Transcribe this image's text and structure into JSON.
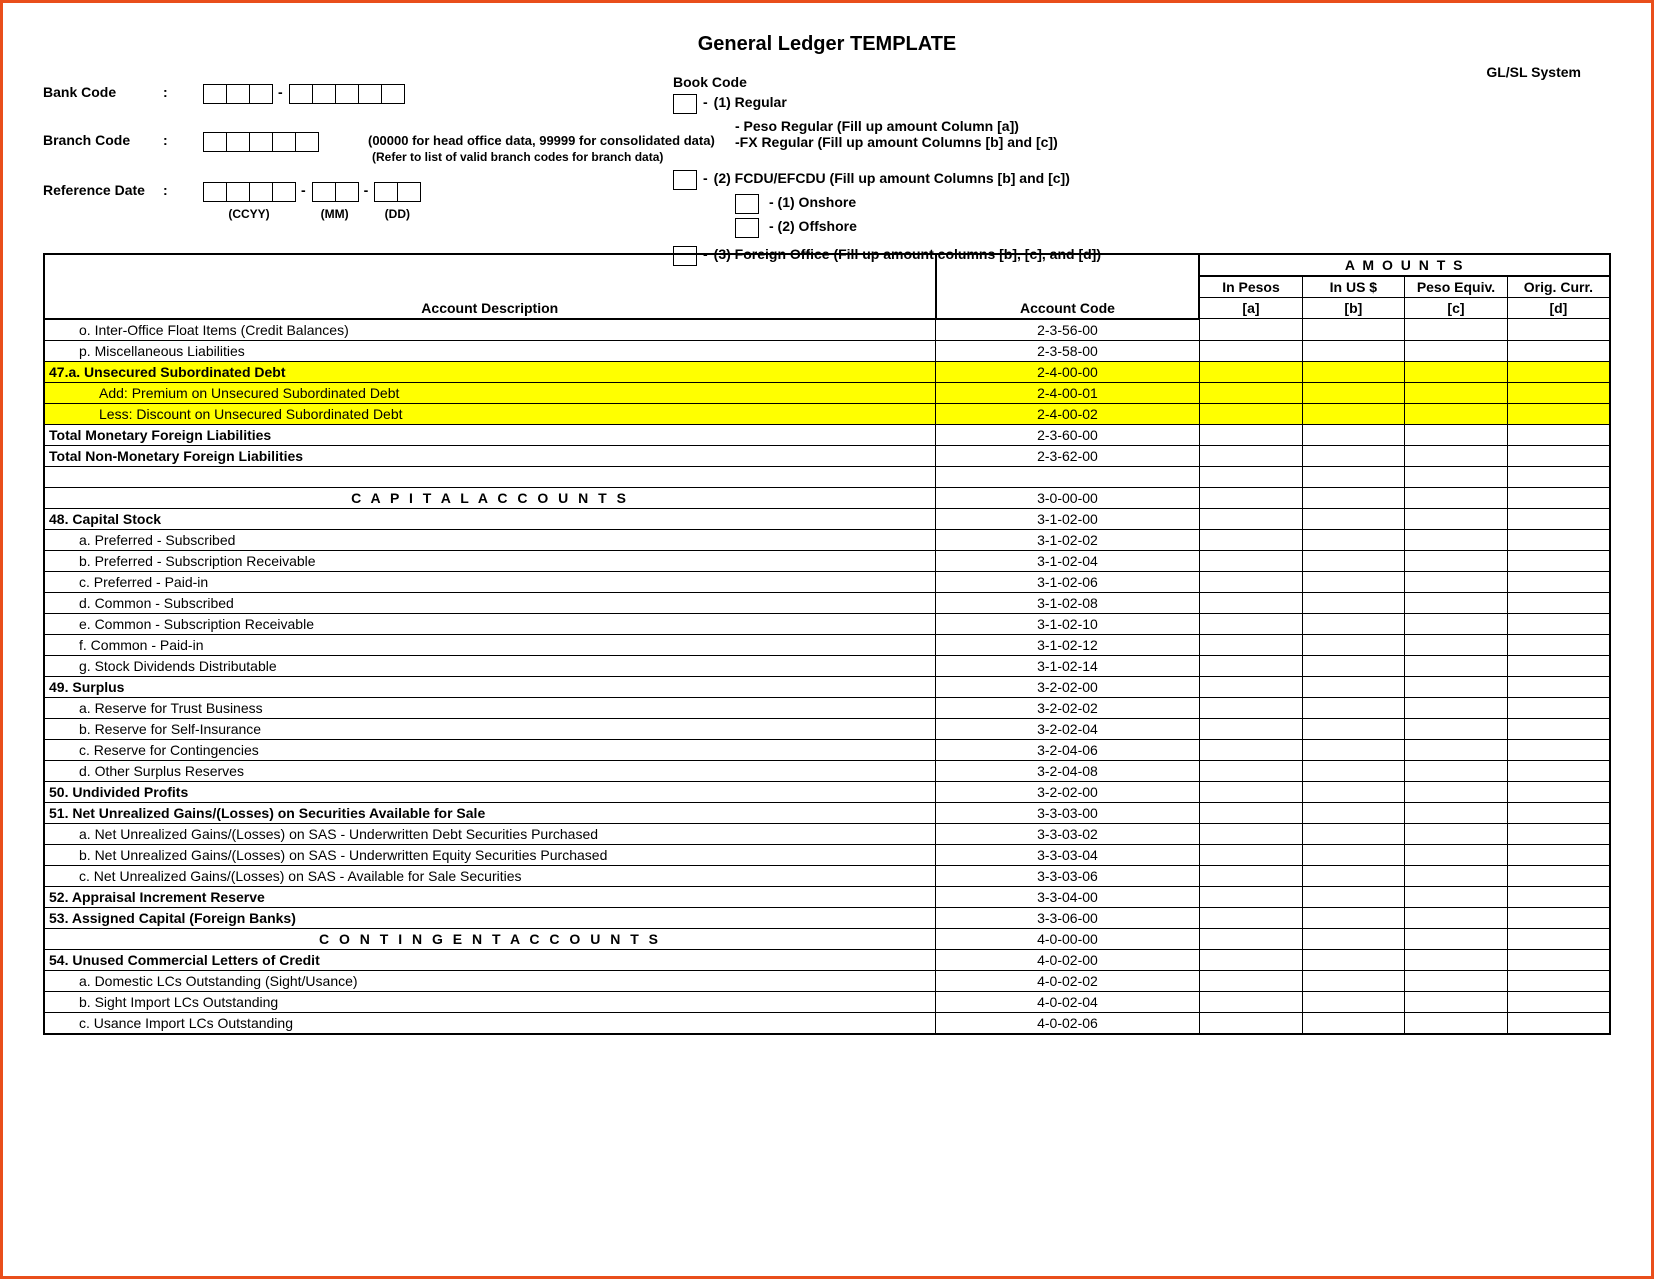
{
  "title": "General Ledger TEMPLATE",
  "system_label": "GL/SL System",
  "header": {
    "bank_code_label": "Bank Code",
    "branch_code_label": "Branch Code",
    "branch_note1": "(00000 for head office data, 99999 for consolidated data)",
    "branch_note2": "(Refer to list of valid branch codes for branch data)",
    "ref_date_label": "Reference Date",
    "ccyy": "(CCYY)",
    "mm": "(MM)",
    "dd": "(DD)",
    "book_code_label": "Book Code",
    "bc1": "(1) Regular",
    "bc1a": "- Peso Regular (Fill up amount Column [a])",
    "bc1b": "-FX Regular (Fill up amount Columns [b] and [c])",
    "bc2": "(2) FCDU/EFCDU (Fill up amount Columns [b] and [c])",
    "bc2a": "-   (1) Onshore",
    "bc2b": "-   (2) Offshore",
    "bc3": "(3) Foreign Office (Fill up amount columns [b], [c], and [d])"
  },
  "table_headers": {
    "amounts": "A M O U N T S",
    "desc": "Account Description",
    "code": "Account Code",
    "pesos": "In Pesos",
    "usd": "In US $",
    "peq": "Peso Equiv.",
    "orig": "Orig. Curr.",
    "a": "[a]",
    "b": "[b]",
    "c": "[c]",
    "d": "[d]"
  },
  "rows": [
    {
      "desc": "o.  Inter-Office Float Items (Credit Balances)",
      "code": "2-3-56-00",
      "indent": 1
    },
    {
      "desc": "p.  Miscellaneous Liabilities",
      "code": "2-3-58-00",
      "indent": 1
    },
    {
      "desc": "47.a.  Unsecured Subordinated Debt",
      "code": "2-4-00-00",
      "indent": 0,
      "bold": true,
      "hl": true
    },
    {
      "desc": "Add:  Premium on Unsecured Subordinated Debt",
      "code": "2-4-00-01",
      "indent": 2,
      "hl": true
    },
    {
      "desc": "Less:   Discount on Unsecured Subordinated Debt",
      "code": "2-4-00-02",
      "indent": 2,
      "hl": true
    },
    {
      "desc": "Total Monetary Foreign Liabilities",
      "code": "2-3-60-00",
      "indent": 0,
      "bold": true
    },
    {
      "desc": "Total Non-Monetary Foreign Liabilities",
      "code": "2-3-62-00",
      "indent": 0,
      "bold": true
    },
    {
      "desc": "",
      "code": "",
      "indent": 0,
      "blank": true
    },
    {
      "desc": "C A P I T A L    A C C O U N T S",
      "code": "3-0-00-00",
      "section": true
    },
    {
      "desc": "48.  Capital Stock",
      "code": "3-1-02-00",
      "indent": 0,
      "bold": true
    },
    {
      "desc": "a.  Preferred - Subscribed",
      "code": "3-1-02-02",
      "indent": 1
    },
    {
      "desc": "b.  Preferred - Subscription Receivable",
      "code": "3-1-02-04",
      "indent": 1
    },
    {
      "desc": "c.  Preferred - Paid-in",
      "code": "3-1-02-06",
      "indent": 1
    },
    {
      "desc": "d.  Common - Subscribed",
      "code": "3-1-02-08",
      "indent": 1
    },
    {
      "desc": "e.  Common - Subscription Receivable",
      "code": "3-1-02-10",
      "indent": 1
    },
    {
      "desc": "f.  Common - Paid-in",
      "code": "3-1-02-12",
      "indent": 1
    },
    {
      "desc": "g.  Stock Dividends Distributable",
      "code": "3-1-02-14",
      "indent": 1
    },
    {
      "desc": "49.   Surplus",
      "code": "3-2-02-00",
      "indent": 0,
      "bold": true
    },
    {
      "desc": "a.  Reserve for Trust Business",
      "code": "3-2-02-02",
      "indent": 1
    },
    {
      "desc": "b.  Reserve for Self-Insurance",
      "code": "3-2-02-04",
      "indent": 1
    },
    {
      "desc": "c.  Reserve for Contingencies",
      "code": "3-2-04-06",
      "indent": 1
    },
    {
      "desc": "d.  Other Surplus Reserves",
      "code": "3-2-04-08",
      "indent": 1
    },
    {
      "desc": "50.   Undivided Profits",
      "code": "3-2-02-00",
      "indent": 0,
      "bold": true
    },
    {
      "desc": "51.  Net Unrealized Gains/(Losses) on Securities Available for Sale",
      "code": "3-3-03-00",
      "indent": 0,
      "bold": true
    },
    {
      "desc": "a.  Net Unrealized Gains/(Losses) on SAS - Underwritten Debt Securities Purchased",
      "code": "3-3-03-02",
      "indent": 1
    },
    {
      "desc": "b.  Net Unrealized Gains/(Losses) on SAS - Underwritten Equity Securities Purchased",
      "code": "3-3-03-04",
      "indent": 1
    },
    {
      "desc": "c.  Net Unrealized Gains/(Losses) on SAS - Available for Sale Securities",
      "code": "3-3-03-06",
      "indent": 1
    },
    {
      "desc": "52.   Appraisal Increment Reserve",
      "code": "3-3-04-00",
      "indent": 0,
      "bold": true
    },
    {
      "desc": "53.   Assigned Capital (Foreign Banks)",
      "code": "3-3-06-00",
      "indent": 0,
      "bold": true
    },
    {
      "desc": "C O N T I N G E N T   A C C O U N T S",
      "code": "4-0-00-00",
      "section": true
    },
    {
      "desc": "54.  Unused Commercial Letters of Credit",
      "code": "4-0-02-00",
      "indent": 0,
      "bold": true
    },
    {
      "desc": "a.  Domestic LCs Outstanding (Sight/Usance)",
      "code": "4-0-02-02",
      "indent": 1
    },
    {
      "desc": "b.  Sight Import LCs Outstanding",
      "code": "4-0-02-04",
      "indent": 1
    },
    {
      "desc": "c.  Usance Import LCs Outstanding",
      "code": "4-0-02-06",
      "indent": 1
    }
  ]
}
